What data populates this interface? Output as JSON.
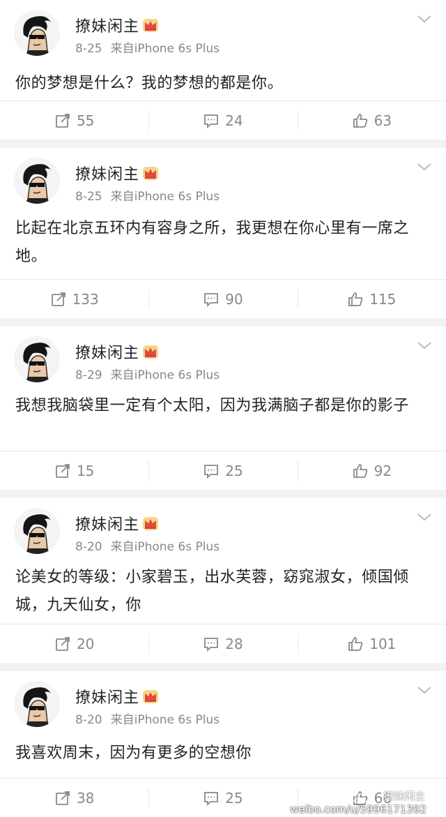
{
  "posts": [
    {
      "name": "撩妹闲主",
      "date": "8-25",
      "source": "来自iPhone 6s Plus",
      "text": "你的梦想是什么？我的梦想的都是你。",
      "reposts": "55",
      "comments": "24",
      "likes": "63"
    },
    {
      "name": "撩妹闲主",
      "date": "8-25",
      "source": "来自iPhone 6s Plus",
      "text": "比起在北京五环内有容身之所，我更想在你心里有一席之地。",
      "reposts": "133",
      "comments": "90",
      "likes": "115"
    },
    {
      "name": "撩妹闲主",
      "date": "8-29",
      "source": "来自iPhone 6s Plus",
      "text": "我想我脑袋里一定有个太阳，因为我满脑子都是你的影子",
      "reposts": "15",
      "comments": "25",
      "likes": "92"
    },
    {
      "name": "撩妹闲主",
      "date": "8-20",
      "source": "来自iPhone 6s Plus",
      "text": "论美女的等级：小家碧玉，出水芙蓉，窈窕淑女，倾国倾城，九天仙女，你",
      "reposts": "20",
      "comments": "28",
      "likes": "101"
    },
    {
      "name": "撩妹闲主",
      "date": "8-20",
      "source": "来自iPhone 6s Plus",
      "text": "我喜欢周末，因为有更多的空想你",
      "reposts": "38",
      "comments": "25",
      "likes": "66"
    }
  ],
  "watermark": {
    "url": "weibo.com/u/5996171392",
    "handle": "撩妹闲主"
  },
  "colors": {
    "text": "#222222",
    "muted": "#888888",
    "card": "#ffffff",
    "background": "#f2f2f2",
    "crown": "#f2a93b"
  },
  "icons": [
    "avatar",
    "crown-badge-icon",
    "chevron-down-icon",
    "repost-icon",
    "comment-icon",
    "like-icon",
    "weibo-logo-icon"
  ]
}
